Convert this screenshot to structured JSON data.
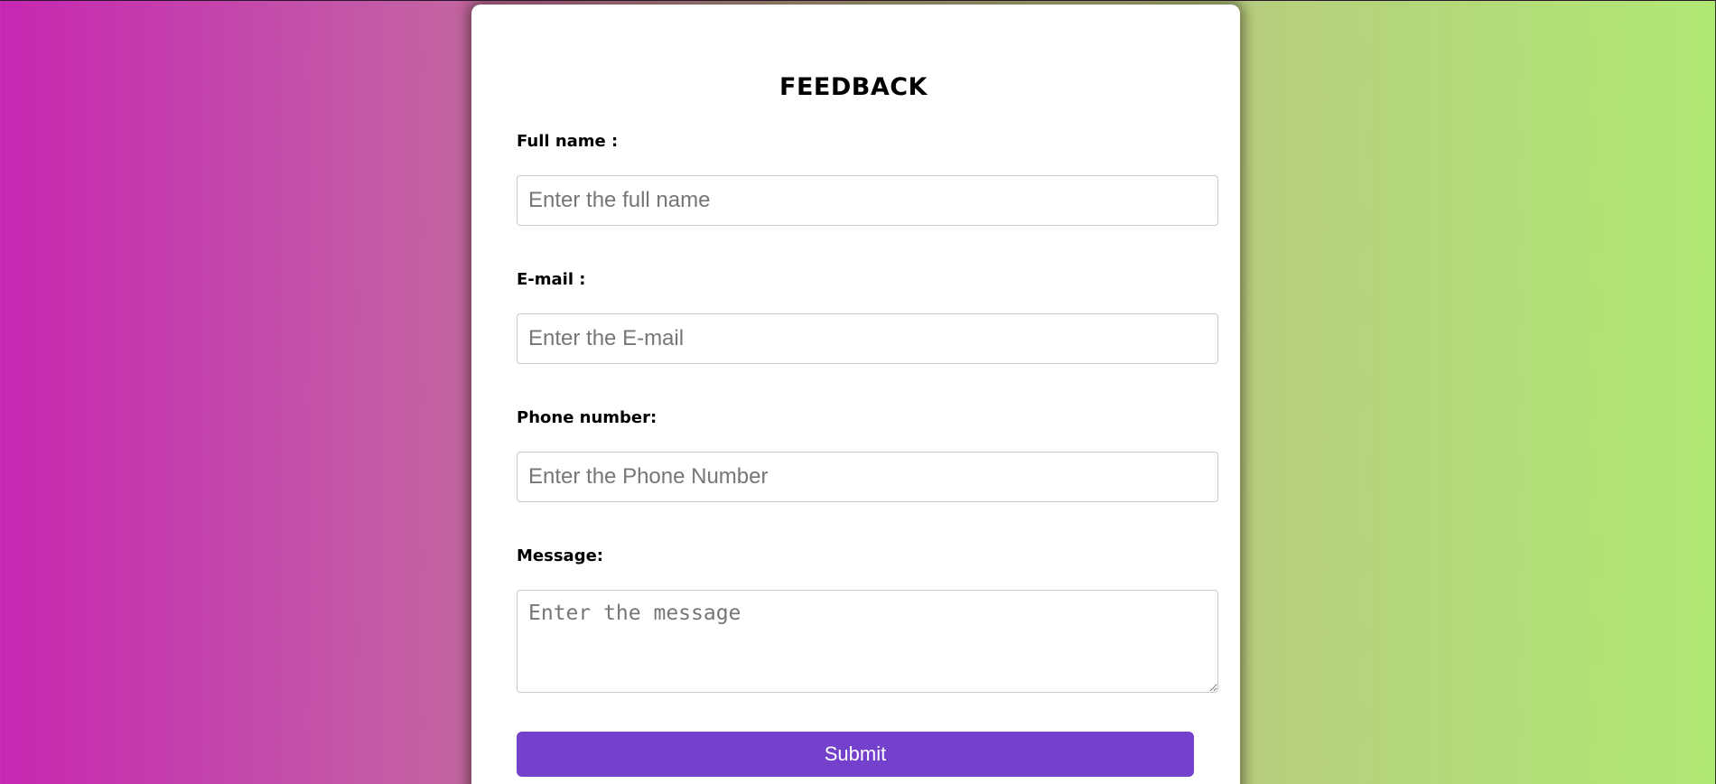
{
  "form": {
    "title": "FEEDBACK",
    "full_name": {
      "label": "Full name :",
      "value": "",
      "placeholder": "Enter the full name"
    },
    "email": {
      "label": "E-mail :",
      "value": "",
      "placeholder": "Enter the E-mail"
    },
    "phone": {
      "label": "Phone number:",
      "value": "",
      "placeholder": "Enter the Phone Number"
    },
    "message": {
      "label": "Message:",
      "value": "",
      "placeholder": "Enter the message"
    },
    "submit_label": "Submit"
  },
  "colors": {
    "accent": "#7341cc",
    "gradient_left": "#c627b2",
    "gradient_right": "#b0e874"
  }
}
